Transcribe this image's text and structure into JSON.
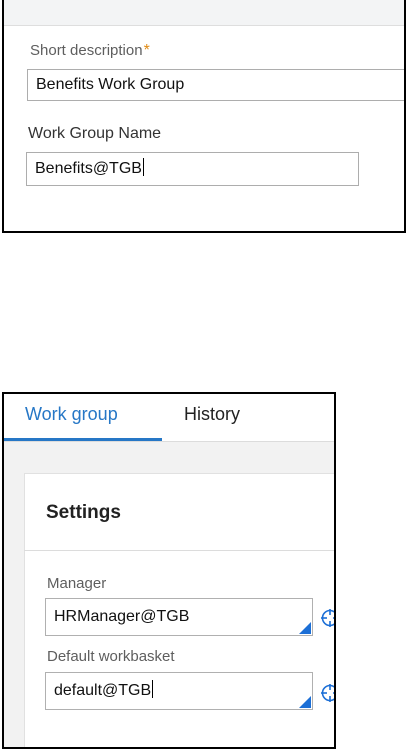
{
  "form_top": {
    "short_description": {
      "label": "Short description",
      "required_marker": "*",
      "value": "Benefits Work Group"
    },
    "work_group_name": {
      "label": "Work Group Name",
      "value": "Benefits@TGB"
    }
  },
  "form_bottom": {
    "tabs": [
      {
        "label": "Work group",
        "active": true
      },
      {
        "label": "History",
        "active": false
      }
    ],
    "settings": {
      "title": "Settings",
      "manager": {
        "label": "Manager",
        "value": "HRManager@TGB",
        "lookup_icon": "crosshair-icon"
      },
      "default_workbasket": {
        "label": "Default workbasket",
        "value": "default@TGB",
        "lookup_icon": "crosshair-icon"
      }
    }
  },
  "colors": {
    "accent": "#2677c6",
    "required": "#e08a13",
    "dropdown_corner": "#1c6fd6"
  }
}
